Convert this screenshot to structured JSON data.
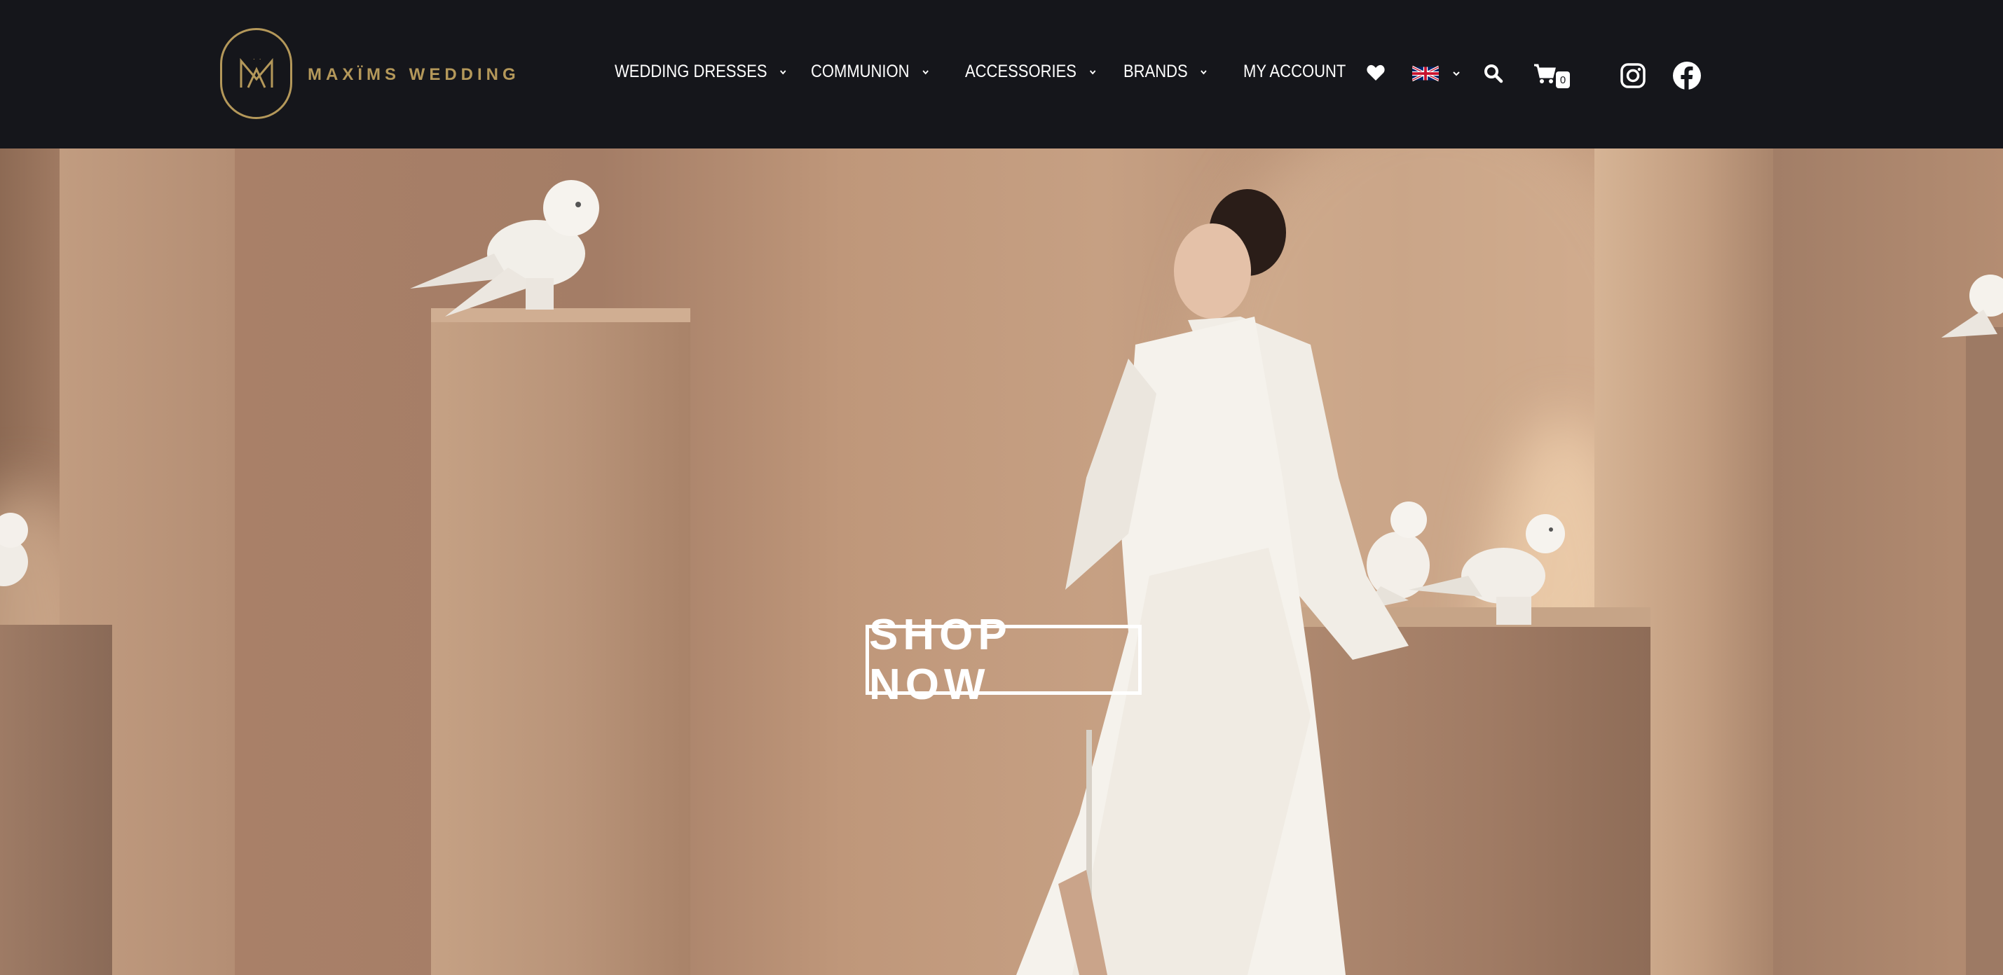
{
  "brand": {
    "name": "MAXÏMS WEDDING"
  },
  "nav": {
    "items": [
      {
        "label": "WEDDING DRESSES",
        "has_dropdown": true
      },
      {
        "label": "COMMUNION",
        "has_dropdown": true
      },
      {
        "label": "ACCESSORIES",
        "has_dropdown": true
      },
      {
        "label": "BRANDS",
        "has_dropdown": true
      },
      {
        "label": "MY ACCOUNT",
        "has_dropdown": false
      }
    ]
  },
  "header_icons": {
    "wishlist": "heart-icon",
    "language": "uk-flag-icon",
    "search": "search-icon",
    "cart": "cart-icon",
    "cart_count": "0",
    "instagram": "instagram-icon",
    "facebook": "facebook-icon"
  },
  "hero": {
    "cta_label": "SHOP NOW"
  },
  "colors": {
    "header_bg": "#15161b",
    "brand_gold": "#b4985a",
    "hero_tone": "#c6a083"
  }
}
